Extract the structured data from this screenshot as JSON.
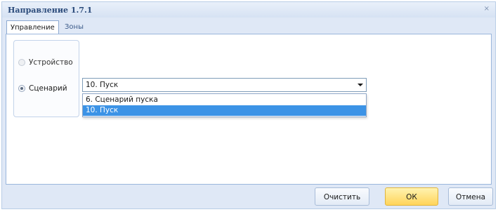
{
  "dialog": {
    "title": "Направление 1.7.1",
    "close": "×"
  },
  "tabs": [
    {
      "label": "Управление",
      "active": true
    },
    {
      "label": "Зоны",
      "active": false
    }
  ],
  "radios": [
    {
      "label": "Устройство",
      "checked": false,
      "disabled": true
    },
    {
      "label": "Сценарий",
      "checked": true,
      "disabled": false
    }
  ],
  "combo": {
    "value": "10. Пуск",
    "icon": "chevron-down-icon"
  },
  "dropdown": {
    "options": [
      "6. Сценарий пуска",
      "10. Пуск"
    ],
    "selected_index": 1,
    "highlight_color": "#3c93e6"
  },
  "footer": {
    "clear_label": "Очистить",
    "ok_label": "ОК",
    "cancel_label": "Отмена",
    "ok_color": "#ffd45a"
  }
}
